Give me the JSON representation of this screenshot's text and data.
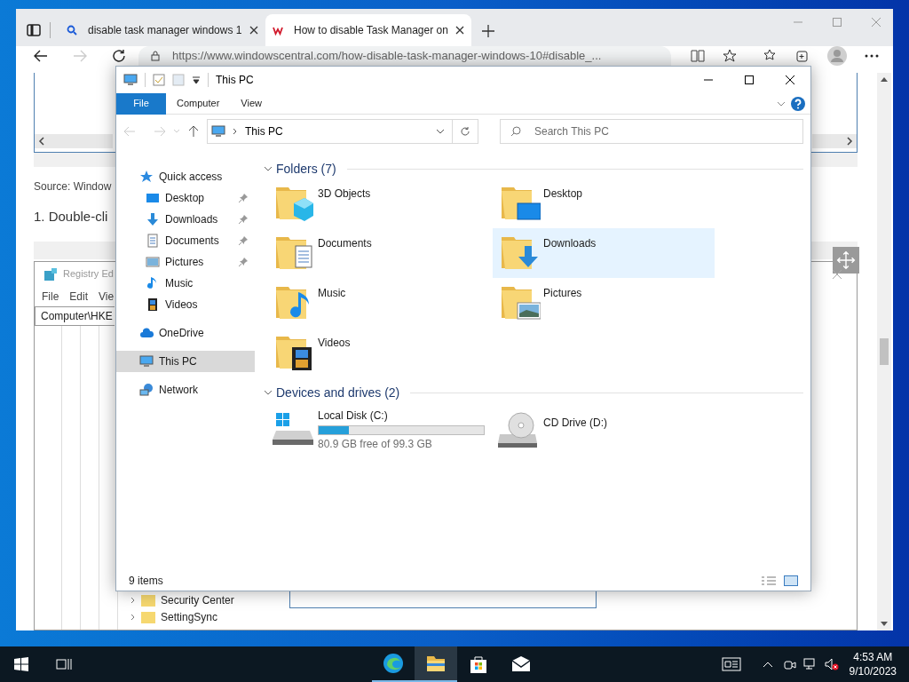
{
  "browser": {
    "tabs": [
      {
        "title": "disable task manager windows 1",
        "selected": false
      },
      {
        "title": "How to disable Task Manager on",
        "selected": true
      }
    ],
    "address": "https://www.windowscentral.com/how-disable-task-manager-windows-10#disable_..."
  },
  "article": {
    "caption": "Source: Window",
    "step": "1. Double-cli",
    "registry": {
      "title": "Registry Ed",
      "menu": [
        "File",
        "Edit",
        "Vie"
      ],
      "path": "Computer\\HKE",
      "tree": [
        "Security Center",
        "SettingSync"
      ]
    }
  },
  "explorer": {
    "title": "This PC",
    "ribbon_tabs": [
      {
        "label": "File",
        "kind": "file"
      },
      {
        "label": "Computer",
        "kind": "tab"
      },
      {
        "label": "View",
        "kind": "tab"
      }
    ],
    "address": "This PC",
    "search": {
      "placeholder": "Search This PC"
    },
    "nav": [
      {
        "label": "Quick access",
        "kind": "star",
        "selected": false,
        "children": [
          {
            "label": "Desktop",
            "kind": "desktop",
            "pinned": true,
            "selected": false
          },
          {
            "label": "Downloads",
            "kind": "downloads",
            "pinned": true,
            "selected": false
          },
          {
            "label": "Documents",
            "kind": "documents",
            "pinned": true,
            "selected": false
          },
          {
            "label": "Pictures",
            "kind": "pictures",
            "pinned": true,
            "selected": false
          },
          {
            "label": "Music",
            "kind": "music",
            "pinned": false,
            "selected": false
          },
          {
            "label": "Videos",
            "kind": "videos",
            "pinned": false,
            "selected": false
          }
        ]
      },
      {
        "label": "OneDrive",
        "kind": "cloud",
        "selected": false
      },
      {
        "label": "This PC",
        "kind": "pc",
        "selected": true
      },
      {
        "label": "Network",
        "kind": "network",
        "selected": false
      }
    ],
    "folders": {
      "title": "Folders (7)",
      "expanded": true,
      "items": [
        {
          "label": "3D Objects",
          "kind": "objects",
          "selected": false
        },
        {
          "label": "Desktop",
          "kind": "desktop",
          "selected": false
        },
        {
          "label": "Documents",
          "kind": "documents",
          "selected": false
        },
        {
          "label": "Downloads",
          "kind": "downloads",
          "selected": true
        },
        {
          "label": "Music",
          "kind": "music",
          "selected": false
        },
        {
          "label": "Pictures",
          "kind": "pictures",
          "selected": false
        },
        {
          "label": "Videos",
          "kind": "videos",
          "selected": false
        }
      ]
    },
    "drives": {
      "title": "Devices and drives (2)",
      "expanded": true,
      "items": [
        {
          "label": "Local Disk (C:)",
          "kind": "disk",
          "level": 0.185,
          "free": "80.9 GB free of 99.3 GB"
        },
        {
          "label": "CD Drive (D:)",
          "kind": "cd"
        }
      ]
    },
    "status": "9 items"
  },
  "taskbar": {
    "apps": [
      {
        "kind": "edge",
        "selected": false,
        "running": true
      },
      {
        "kind": "explorer",
        "selected": true,
        "running": true
      },
      {
        "kind": "store",
        "selected": false,
        "running": false
      },
      {
        "kind": "mail",
        "selected": false,
        "running": false
      }
    ],
    "time": "4:53 AM",
    "date": "9/10/2023"
  }
}
